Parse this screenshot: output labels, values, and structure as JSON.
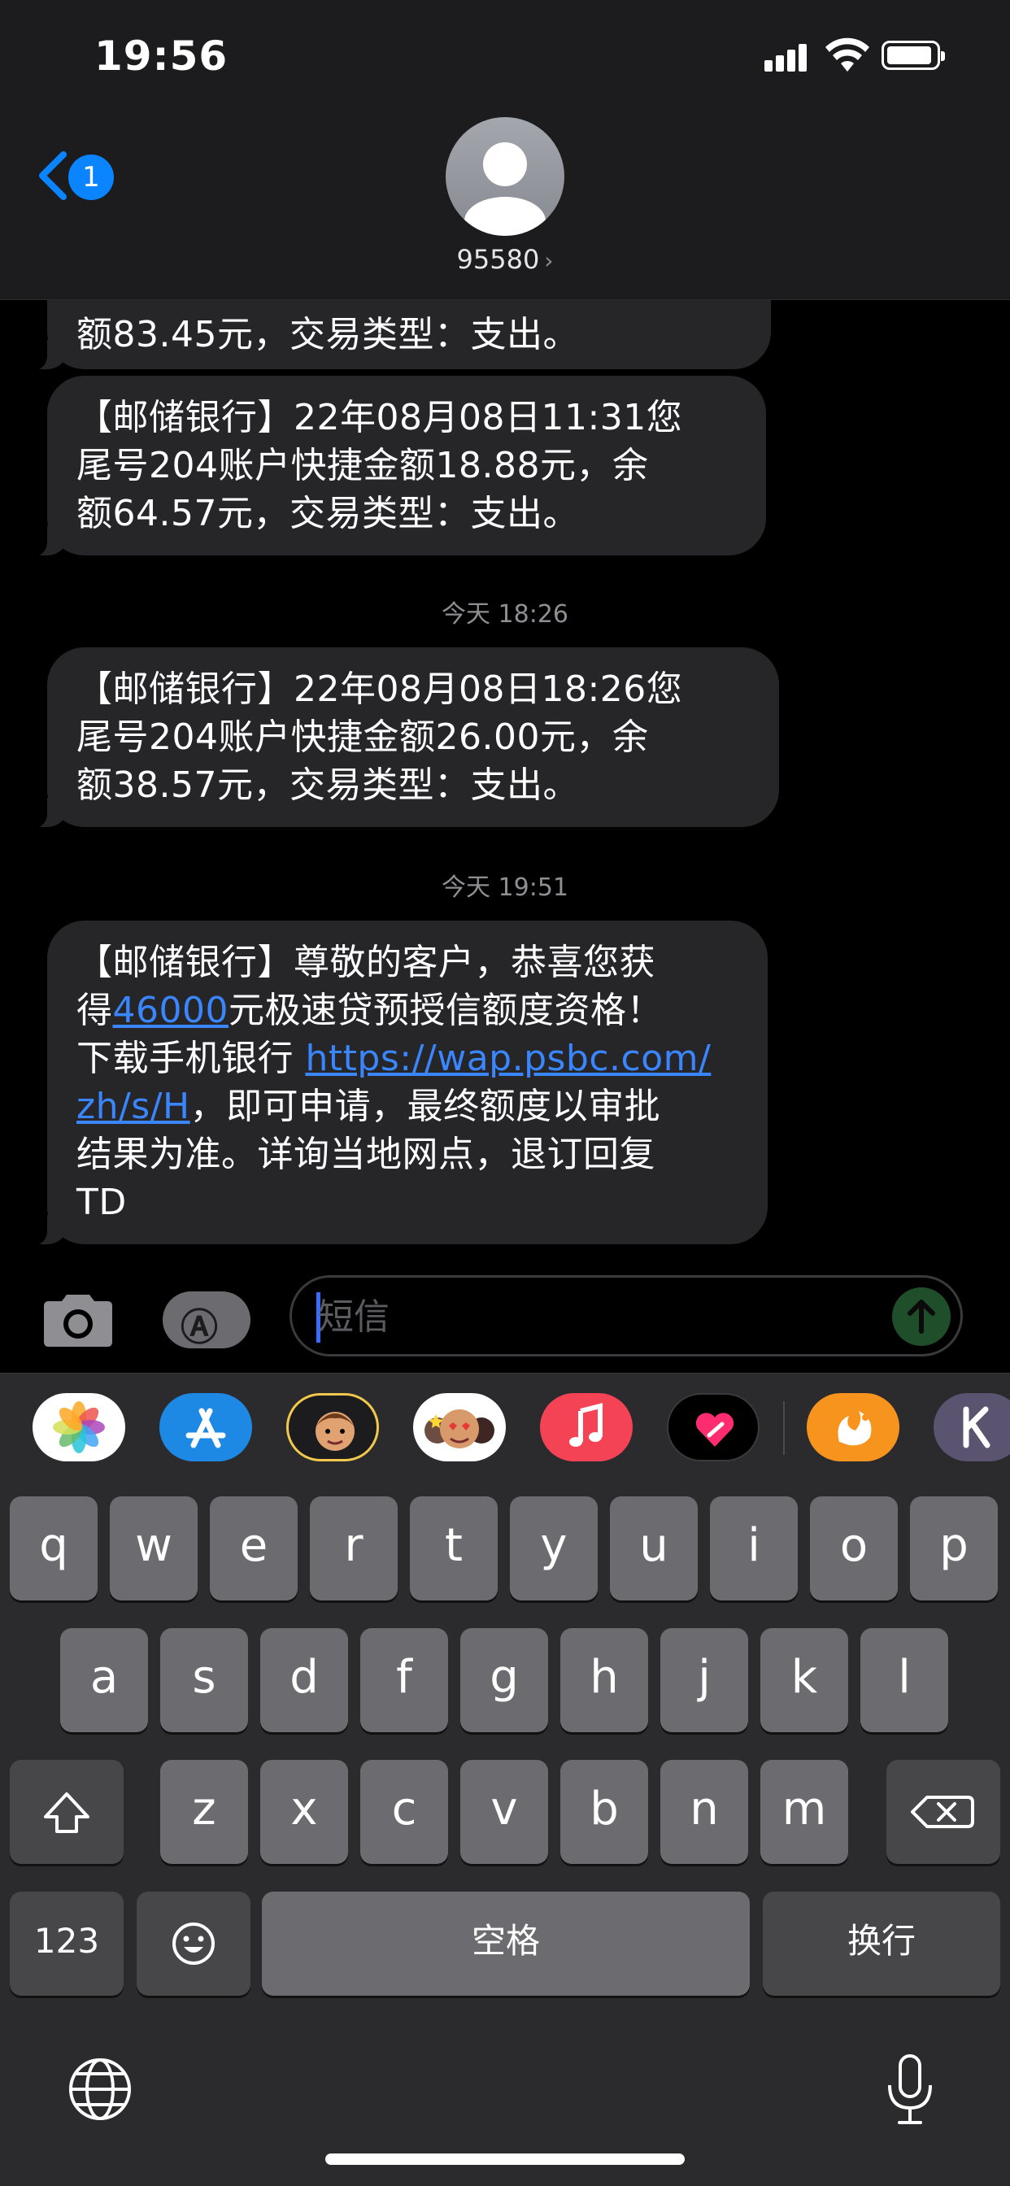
{
  "status_bar": {
    "time": "19:56",
    "icons": [
      "signal-icon",
      "wifi-icon",
      "battery-icon"
    ]
  },
  "header": {
    "back_badge": "1",
    "contact": "95580",
    "contact_chevron": "›"
  },
  "messages": [
    {
      "text": "额83.45元，交易类型：支出。"
    },
    {
      "text": "【邮储银行】22年08月08日11:31您尾号204账户快捷金额18.88元，余额64.57元，交易类型：支出。",
      "line1": "【邮储银行】22年08月08日11:31您",
      "line2": "尾号204账户快捷金额18.88元，余",
      "line3": "额64.57元，交易类型：支出。"
    },
    {
      "timestamp": "今天 18:26"
    },
    {
      "line1": "【邮储银行】22年08月08日18:26您",
      "line2": "尾号204账户快捷金额26.00元，余",
      "line3": "额38.57元，交易类型：支出。"
    },
    {
      "timestamp": "今天 19:51"
    },
    {
      "line1": "【邮储银行】尊敬的客户，恭喜您获",
      "line2_pre": "得",
      "amount": "46000",
      "line2_post": "元极速贷预授信额度资格！",
      "line3_pre": "下载手机银行",
      "link1": "https://wap.psbc.com/",
      "link2": "zh/s/H",
      "line4_post": "，即可申请，最终额度以审批",
      "line5": "结果为准。详询当地网点，退订回复",
      "line6": "TD"
    }
  ],
  "compose": {
    "placeholder": "短信"
  },
  "app_drawer": [
    "photos-app",
    "app-store-app",
    "memoji-app",
    "animoji-app",
    "music-app",
    "digital-touch-app",
    "uc-browser-app",
    "k-app"
  ],
  "keyboard": {
    "row1": [
      "q",
      "w",
      "e",
      "r",
      "t",
      "y",
      "u",
      "i",
      "o",
      "p"
    ],
    "row2": [
      "a",
      "s",
      "d",
      "f",
      "g",
      "h",
      "j",
      "k",
      "l"
    ],
    "row3": [
      "z",
      "x",
      "c",
      "v",
      "b",
      "n",
      "m"
    ],
    "numbers": "123",
    "space": "空格",
    "return": "换行"
  },
  "colors": {
    "link": "#3a86ff",
    "bubble": "#262629",
    "badge": "#0a84ff"
  }
}
